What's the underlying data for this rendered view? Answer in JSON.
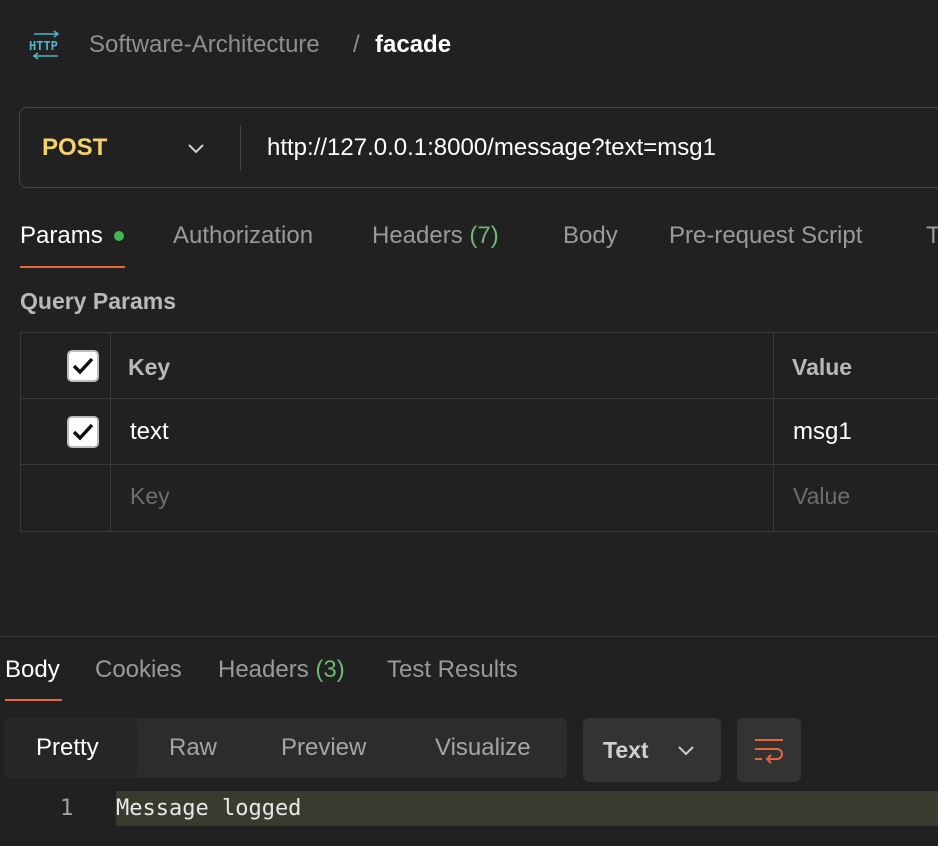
{
  "header": {
    "icon": "http-icon",
    "breadcrumb_parent": "Software-Architecture",
    "separator": "/",
    "current": "facade"
  },
  "request": {
    "method": "POST",
    "url": "http://127.0.0.1:8000/message?text=msg1"
  },
  "request_tabs": [
    {
      "label": "Params",
      "active": true,
      "indicator": "green-dot"
    },
    {
      "label": "Authorization"
    },
    {
      "label": "Headers",
      "count": "(7)"
    },
    {
      "label": "Body"
    },
    {
      "label": "Pre-request Script"
    },
    {
      "label": "T"
    }
  ],
  "query_params": {
    "title": "Query Params",
    "header": {
      "key": "Key",
      "value": "Value",
      "checked": true
    },
    "rows": [
      {
        "key": "text",
        "value": "msg1",
        "checked": true
      }
    ],
    "new_row": {
      "key_placeholder": "Key",
      "value_placeholder": "Value"
    }
  },
  "response": {
    "tabs": [
      {
        "label": "Body",
        "active": true
      },
      {
        "label": "Cookies"
      },
      {
        "label": "Headers",
        "count": "(3)"
      },
      {
        "label": "Test Results"
      }
    ],
    "view_modes": [
      "Pretty",
      "Raw",
      "Preview",
      "Visualize"
    ],
    "active_view": "Pretty",
    "format": "Text",
    "lines": [
      {
        "number": "1",
        "text": "Message logged"
      }
    ]
  },
  "colors": {
    "method": "#f2d36c",
    "accent": "#e8663d",
    "count": "#6fb86f",
    "status_dot": "#3fb950"
  }
}
